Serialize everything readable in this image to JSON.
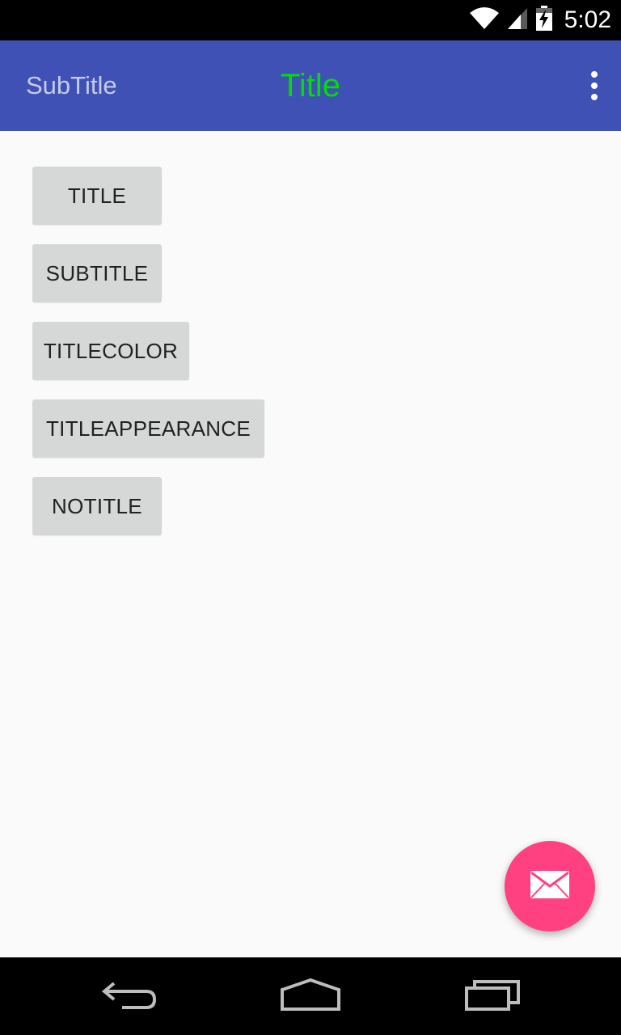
{
  "status_bar": {
    "time": "5:02",
    "icons": [
      "wifi-icon",
      "signal-icon",
      "battery-charging-icon"
    ]
  },
  "toolbar": {
    "subtitle": "SubTitle",
    "title": "Title",
    "title_color": "#00e000",
    "subtitle_color": "#c5cae9",
    "background": "#3f51b5",
    "menu_icon": "more-vert-icon"
  },
  "buttons": [
    {
      "label": "TITLE"
    },
    {
      "label": "SUBTITLE"
    },
    {
      "label": "TITLECOLOR"
    },
    {
      "label": "TITLEAPPEARANCE"
    },
    {
      "label": "NOTITLE"
    }
  ],
  "fab": {
    "icon": "mail-icon",
    "color": "#ff4081"
  },
  "nav_bar": {
    "icons": [
      "back-icon",
      "home-icon",
      "recents-icon"
    ]
  }
}
